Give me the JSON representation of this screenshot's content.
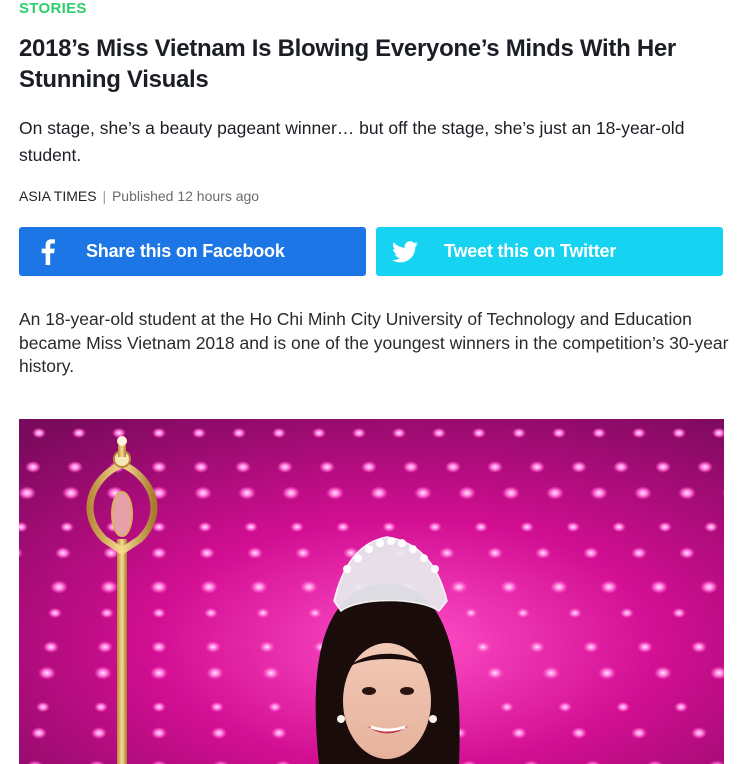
{
  "article": {
    "category": "STORIES",
    "headline": "2018’s Miss Vietnam Is Blowing Everyone’s Minds With Her Stunning Visuals",
    "dek": "On stage, she’s a beauty pageant winner… but off the stage, she’s just an 18-year-old student.",
    "byline": {
      "source": "ASIA TIMES",
      "separator": "|",
      "published": "Published 12 hours ago"
    },
    "body": "An 18-year-old student at the Ho Chi Minh City University of Technology and Education became Miss Vietnam 2018 and is one of the youngest winners in the competition’s 30-year history."
  },
  "share": {
    "facebook": {
      "label": "Share this on Facebook",
      "icon": "facebook-icon",
      "color": "#1c76e6"
    },
    "twitter": {
      "label": "Tweet this on Twitter",
      "icon": "twitter-icon",
      "color": "#16d3f1"
    }
  },
  "colors": {
    "category": "#2dce6c",
    "hero_background": "#c8108f"
  }
}
